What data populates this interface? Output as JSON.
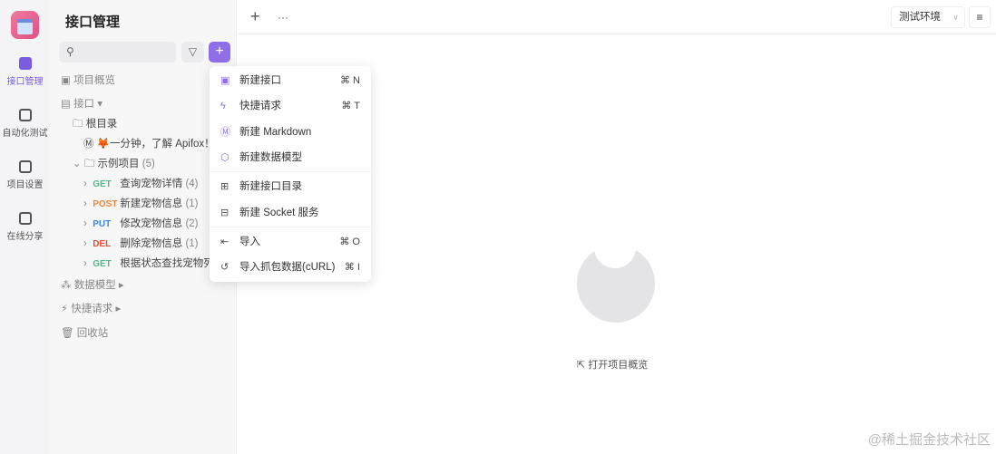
{
  "rail": {
    "items": [
      {
        "label": "接口管理",
        "active": true
      },
      {
        "label": "自动化测试"
      },
      {
        "label": "项目设置"
      },
      {
        "label": "在线分享"
      }
    ]
  },
  "sidebar": {
    "title": "接口管理",
    "filter_icon": "filter-icon",
    "add_icon": "plus-icon",
    "overview": "项目概览",
    "api": "接口",
    "root": "根目录",
    "doc": "🦊一分钟，了解 Apifox！",
    "folder": "示例项目",
    "folder_count": "(5)",
    "endpoints": [
      {
        "method": "GET",
        "color": "#4fb989",
        "name": "查询宠物详情",
        "count": "(4)"
      },
      {
        "method": "POST",
        "color": "#e8873a",
        "name": "新建宠物信息",
        "count": "(1)"
      },
      {
        "method": "PUT",
        "color": "#3a86e8",
        "name": "修改宠物信息",
        "count": "(2)"
      },
      {
        "method": "DEL",
        "color": "#e24c3a",
        "name": "删除宠物信息",
        "count": "(1)"
      },
      {
        "method": "GET",
        "color": "#4fb989",
        "name": "根据状态查找宠物列..",
        "count": ""
      }
    ],
    "data_model": "数据模型",
    "quick": "快捷请求",
    "trash": "回收站"
  },
  "menu": {
    "items": [
      {
        "label": "新建接口",
        "shortcut": "⌘ N"
      },
      {
        "label": "快捷请求",
        "shortcut": "⌘ T"
      },
      {
        "label": "新建 Markdown",
        "shortcut": ""
      },
      {
        "label": "新建数据模型",
        "shortcut": ""
      },
      {
        "label": "新建接口目录",
        "shortcut": ""
      },
      {
        "label": "新建 Socket 服务",
        "shortcut": ""
      },
      {
        "label": "导入",
        "shortcut": "⌘ O"
      },
      {
        "label": "导入抓包数据(cURL)",
        "shortcut": "⌘ I"
      }
    ]
  },
  "topbar": {
    "add": "+",
    "more": "···",
    "env": "测试环境"
  },
  "main": {
    "open_overview": "打开项目概览"
  },
  "watermark": "@稀土掘金技术社区"
}
